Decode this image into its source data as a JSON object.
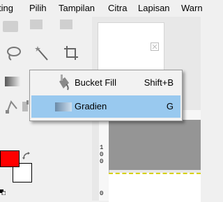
{
  "menubar": {
    "items": [
      {
        "label": "ting"
      },
      {
        "label": "Pilih"
      },
      {
        "label": "Tampilan"
      },
      {
        "label": "Citra"
      },
      {
        "label": "Lapisan"
      },
      {
        "label": "Warn"
      }
    ]
  },
  "popup": {
    "items": [
      {
        "label": "Bucket Fill",
        "shortcut": "Shift+B",
        "icon": "bucket-fill-icon",
        "selected": false
      },
      {
        "label": "Gradien",
        "shortcut": "G",
        "icon": "gradient-icon",
        "selected": true
      }
    ]
  },
  "ruler": {
    "vertical_digits": [
      "1",
      "0",
      "0"
    ],
    "bottom_digit": "0"
  },
  "colors": {
    "foreground": "#ff0000",
    "background": "#ffffff",
    "highlight": "#99c9ef"
  }
}
